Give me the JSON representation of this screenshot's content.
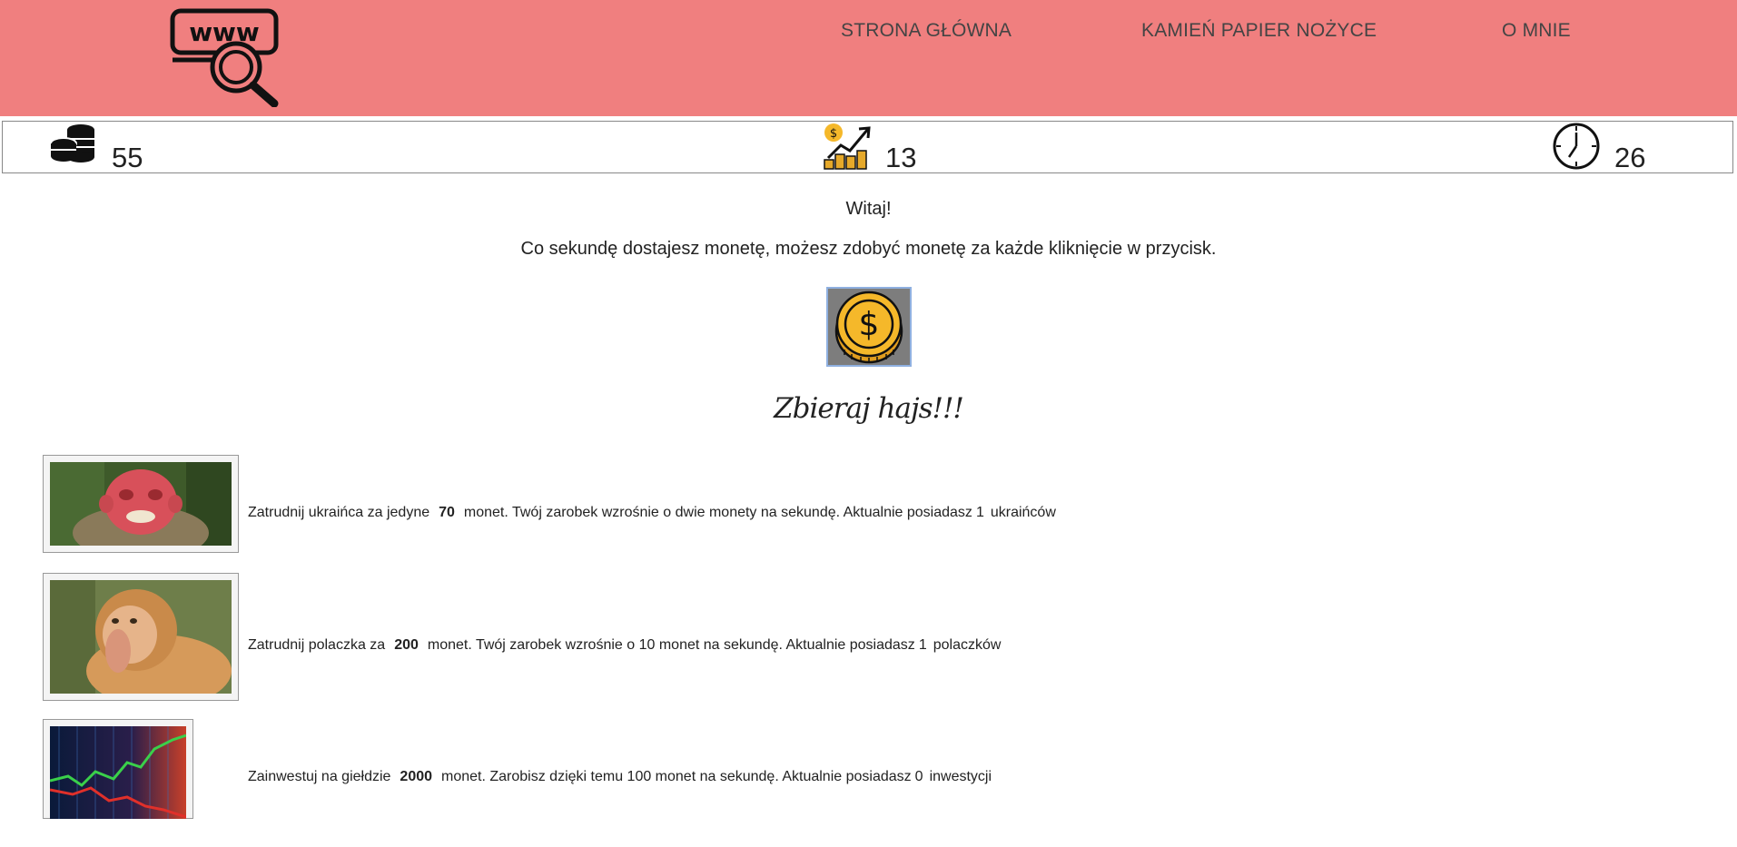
{
  "nav": {
    "items": [
      {
        "label": "STRONA GŁÓWNA"
      },
      {
        "label": "KAMIEŃ PAPIER NOŻYCE"
      },
      {
        "label": "O MNIE"
      }
    ]
  },
  "logo": {
    "text": "www",
    "icon": "www-search-logo"
  },
  "stats": {
    "coins": {
      "icon": "coin-stack-icon",
      "value": "55"
    },
    "income": {
      "icon": "income-growth-icon",
      "value": "13"
    },
    "time": {
      "icon": "clock-icon",
      "value": "26"
    }
  },
  "main": {
    "greeting": "Witaj!",
    "description": "Co sekundę dostajesz monetę, możesz zdobyć monetę za każde kliknięcie w przycisk.",
    "coin_button_icon": "dollar-coin-icon",
    "slogan": "Zbieraj hajs!!!"
  },
  "offers": [
    {
      "image": "bald-uakari-monkey-photo",
      "pre": "Zatrudnij ukraińca za jedyne",
      "price": "70",
      "mid": "monet. Twój zarobek wzrośnie o dwie monety na sekundę. Aktualnie posiadasz",
      "count": "1",
      "unit": "ukraińców"
    },
    {
      "image": "proboscis-monkey-photo",
      "pre": "Zatrudnij polaczka za",
      "price": "200",
      "mid": "monet. Twój zarobek wzrośnie o 10 monet na sekundę. Aktualnie posiadasz",
      "count": "1",
      "unit": "polaczków"
    },
    {
      "image": "stock-chart-photo",
      "pre": "Zainwestuj na giełdzie",
      "price": "2000",
      "mid": "monet. Zarobisz dzięki temu 100 monet na sekundę. Aktualnie posiadasz",
      "count": "0",
      "unit": "inwestycji"
    }
  ],
  "colors": {
    "header_bg": "#f07f7f",
    "coin_gold": "#f5b82a",
    "button_bg": "#7d7d7d"
  }
}
